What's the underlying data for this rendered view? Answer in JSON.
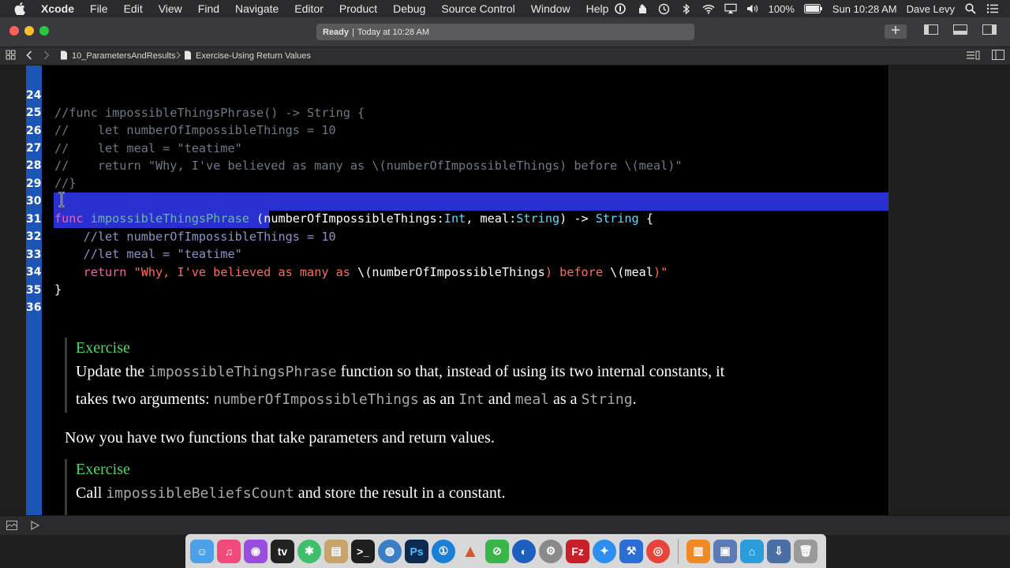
{
  "menubar": {
    "app_name": "Xcode",
    "items": [
      "File",
      "Edit",
      "View",
      "Find",
      "Navigate",
      "Editor",
      "Product",
      "Debug",
      "Source Control",
      "Window",
      "Help"
    ],
    "battery": "100%",
    "clock": "Sun 10:28 AM",
    "user": "Dave Levy"
  },
  "toolbar": {
    "status_bold": "Ready",
    "status_sep": "|",
    "status_time": "Today at 10:28 AM"
  },
  "jumpbar": {
    "crumb_1": "10_ParametersAndResults",
    "crumb_2": "Exercise-Using Return Values"
  },
  "code": {
    "l24": {
      "n": "24",
      "text": "//func impossibleThingsPhrase() -> String {"
    },
    "l25": {
      "n": "25",
      "text": "//    let numberOfImpossibleThings = 10"
    },
    "l26": {
      "n": "26",
      "text": "//    let meal = \"teatime\""
    },
    "l27": {
      "n": "27",
      "text": "//    return \"Why, I've believed as many as \\(numberOfImpossibleThings) before \\(meal)\""
    },
    "l28": {
      "n": "28",
      "text": "//}"
    },
    "l29": {
      "n": "29"
    },
    "l30": {
      "n": "30",
      "kw": "func",
      "fname": "impossibleThingsPhrase",
      "p1": " (numberOfImpossibleThings:",
      "t1": "Int",
      "p2": ", meal:",
      "t2": "String",
      "p3": ") -> ",
      "t3": "String",
      "p4": " {"
    },
    "l31": {
      "n": "31",
      "text": "    //let numberOfImpossibleThings = 10"
    },
    "l32": {
      "n": "32",
      "text": "    //let meal = \"teatime\""
    },
    "l33": {
      "n": "33",
      "kw": "return",
      "s1": " \"Why, I've believed as many as ",
      "p1": "\\(numberOfImpossibleThings",
      "s2": ") before ",
      "p2": "\\(meal",
      "s3": ")\""
    },
    "l34": {
      "n": "34",
      "text": "}"
    },
    "l35": {
      "n": "35"
    },
    "l36": {
      "n": "36"
    }
  },
  "markup": {
    "ex1_title": "Exercise",
    "ex1_a": "Update the ",
    "ex1_code1": "impossibleThingsPhrase",
    "ex1_b": " function so that, instead of using its two internal constants, it",
    "ex1_c": "takes two arguments: ",
    "ex1_code2": "numberOfImpossibleThings",
    "ex1_d": " as an ",
    "ex1_code3": "Int",
    "ex1_e": " and ",
    "ex1_code4": "meal",
    "ex1_f": " as a ",
    "ex1_code5": "String",
    "ex1_g": ".",
    "para": "Now you have two functions that take parameters and return values.",
    "ex2_title": "Exercise",
    "ex2_a": "Call ",
    "ex2_code": "impossibleBeliefsCount",
    "ex2_b": " and store the result in a constant."
  },
  "colors": {
    "keyword": "#fc5fa3",
    "function": "#67b7a4",
    "type": "#5dd8ff",
    "string": "#fc6a5d",
    "comment": "#6c7986",
    "selection": "#2a2fcf",
    "exercise_title": "#4cd964"
  }
}
